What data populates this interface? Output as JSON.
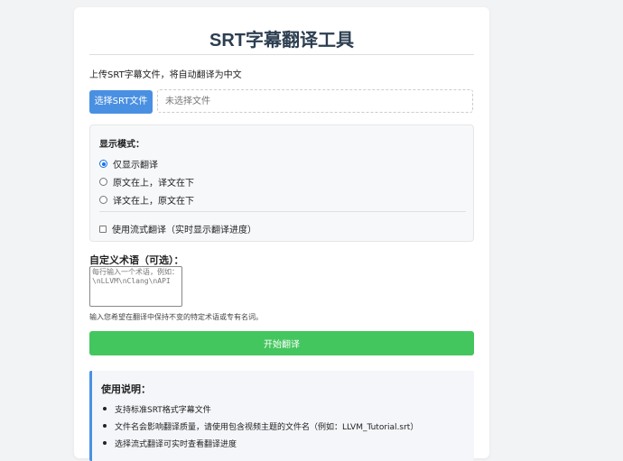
{
  "header": {
    "title": "SRT字幕翻译工具",
    "subtitle": "上传SRT字幕文件，将自动翻译为中文"
  },
  "upload": {
    "button_label": "选择SRT文件",
    "file_status": "未选择文件"
  },
  "display_mode": {
    "title": "显示模式：",
    "options": [
      {
        "label": "仅显示翻译",
        "checked": true
      },
      {
        "label": "原文在上，译文在下",
        "checked": false
      },
      {
        "label": "译文在上，原文在下",
        "checked": false
      }
    ],
    "streaming": {
      "label": "使用流式翻译（实时显示翻译进度）",
      "checked": false
    }
  },
  "terms": {
    "title": "自定义术语（可选）：",
    "placeholder": "每行输入一个术语，例如：\\nLLVM\\nClang\\nAPI",
    "hint": "输入您希望在翻译中保持不变的特定术语或专有名词。"
  },
  "actions": {
    "start_label": "开始翻译"
  },
  "usage": {
    "title": "使用说明：",
    "items": [
      "支持标准SRT格式字幕文件",
      "文件名会影响翻译质量，请使用包含视频主题的文件名（例如：LLVM_Tutorial.srt）",
      "选择流式翻译可实时查看翻译进度"
    ]
  },
  "colors": {
    "primary": "#4a90e2",
    "success": "#43c65e",
    "title": "#2c3e50"
  }
}
